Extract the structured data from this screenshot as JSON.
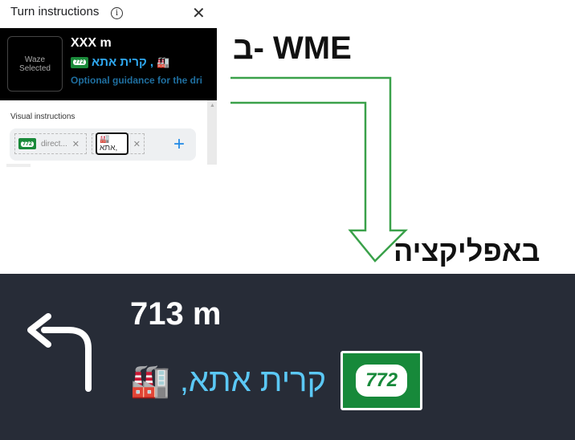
{
  "wme_panel": {
    "title": "Turn instructions",
    "info_icon": "ⓘ",
    "close_icon": "✕",
    "preview": {
      "waze_line1": "Waze",
      "waze_line2": "Selected",
      "distance": "XXX m",
      "shield_number": "772",
      "city": "קרית אתא",
      "separator": " ,",
      "emoji": "🏭",
      "guidance": "Optional guidance for the dri"
    },
    "visual_instructions_label": "Visual instructions",
    "chips": [
      {
        "icon_text": "772",
        "label": "direct...",
        "remove": "✕"
      },
      {
        "icon": "🏭",
        "label": "אתא,",
        "remove": "✕"
      }
    ],
    "add_icon": "+"
  },
  "annotation": {
    "wme_label": "ב- WME",
    "app_label": "באפליקציה",
    "arrow_color": "#3aa14a"
  },
  "app_panel": {
    "distance": "713 m",
    "city": "קרית אתא,",
    "emoji": "🏭",
    "shield_number": "772"
  }
}
